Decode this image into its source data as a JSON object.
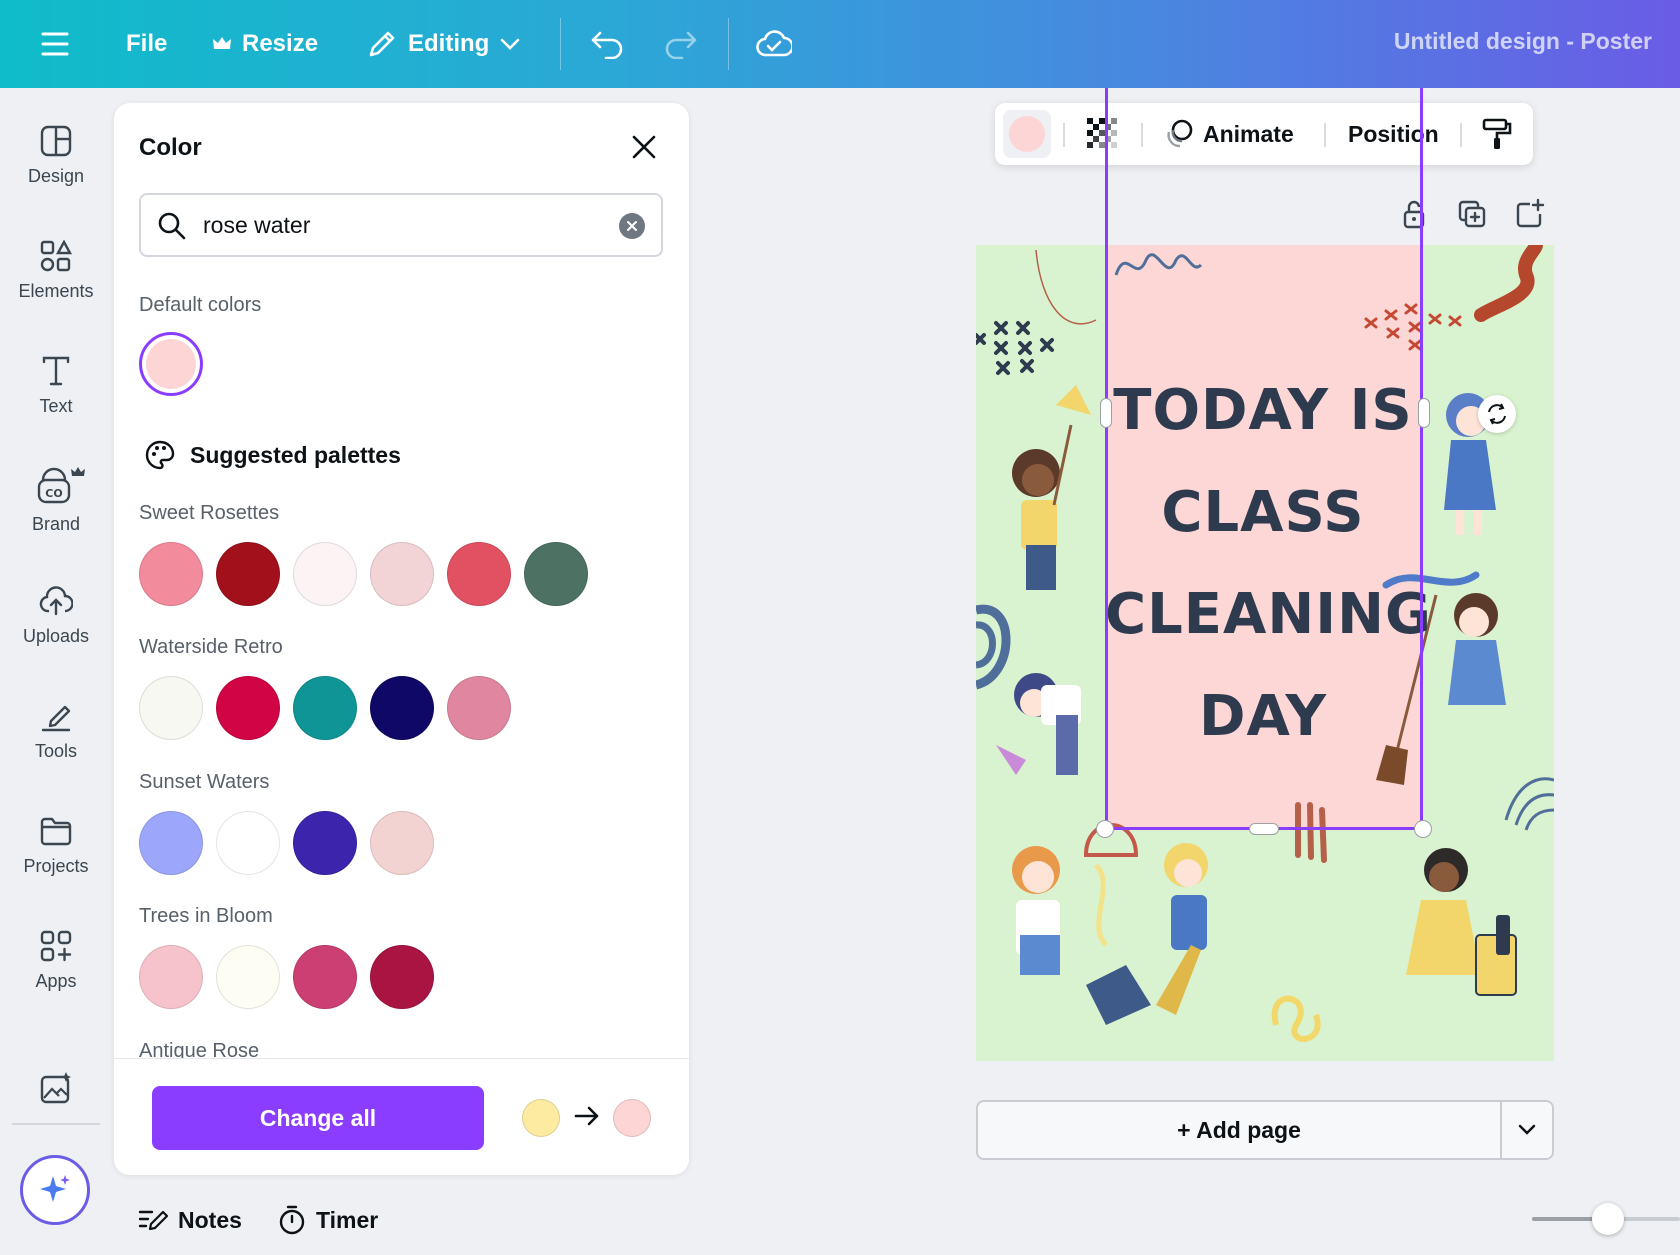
{
  "topbar": {
    "file_label": "File",
    "resize_label": "Resize",
    "editing_label": "Editing",
    "title": "Untitled design - Poster"
  },
  "rail": {
    "items": [
      {
        "label": "Design",
        "icon": "design-icon"
      },
      {
        "label": "Elements",
        "icon": "elements-icon"
      },
      {
        "label": "Text",
        "icon": "text-icon"
      },
      {
        "label": "Brand",
        "icon": "brand-icon"
      },
      {
        "label": "Uploads",
        "icon": "uploads-icon"
      },
      {
        "label": "Tools",
        "icon": "tools-icon"
      },
      {
        "label": "Projects",
        "icon": "projects-icon"
      },
      {
        "label": "Apps",
        "icon": "apps-icon"
      }
    ]
  },
  "color_panel": {
    "title": "Color",
    "search_value": "rose water",
    "default_colors_label": "Default colors",
    "default_color": "#fdd5d5",
    "suggested_label": "Suggested palettes",
    "palettes": [
      {
        "name": "Sweet Rosettes",
        "colors": [
          "#f28b9c",
          "#a1101b",
          "#fbf3f4",
          "#f2d3d6",
          "#e15162",
          "#4d7263"
        ]
      },
      {
        "name": "Waterside Retro",
        "colors": [
          "#f7f8f1",
          "#d10445",
          "#0f9596",
          "#0f0866",
          "#e086a1"
        ]
      },
      {
        "name": "Sunset Waters",
        "colors": [
          "#9ca6fb",
          "#ffffff",
          "#3d24ad",
          "#f3d2d2"
        ]
      },
      {
        "name": "Trees in Bloom",
        "colors": [
          "#f6c3cc",
          "#fdfdf4",
          "#cb3f72",
          "#a91443"
        ]
      },
      {
        "name": "Antique Rose",
        "colors": []
      }
    ],
    "change_all_label": "Change all",
    "from_color": "#fdeba2",
    "to_color": "#fdd5d5"
  },
  "floating_toolbar": {
    "fill_color": "#fdd5d5",
    "animate_label": "Animate",
    "position_label": "Position"
  },
  "canvas": {
    "headline_lines": [
      "TODAY IS",
      "CLASS",
      "CLEANING",
      "DAY"
    ],
    "background": "#d9f3d0",
    "box_color": "#fdd6d6"
  },
  "add_page_label": "+ Add page",
  "bottom": {
    "notes_label": "Notes",
    "timer_label": "Timer"
  },
  "accent": "#8b3dff"
}
